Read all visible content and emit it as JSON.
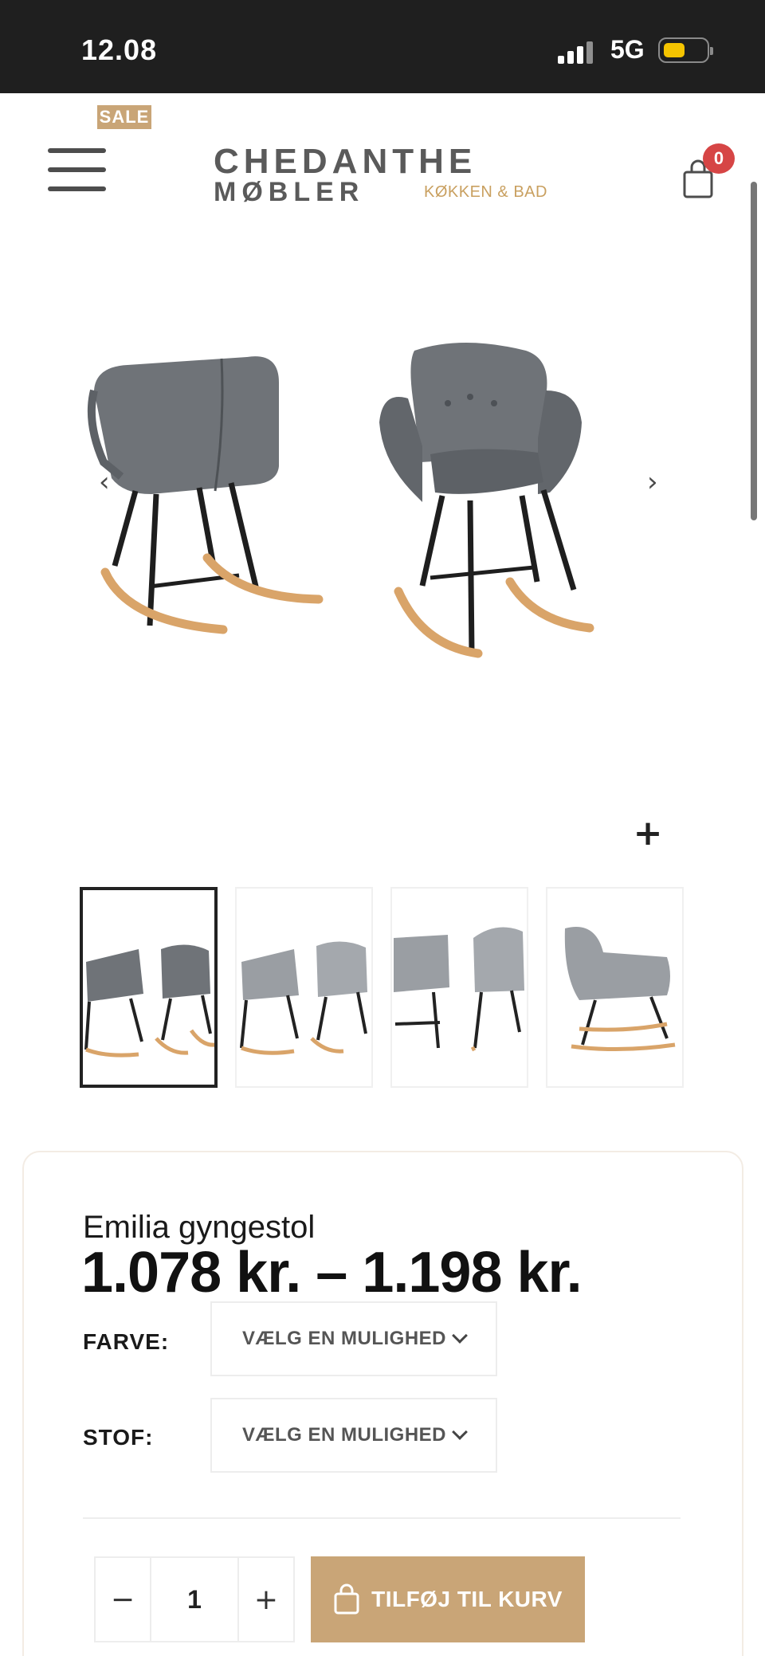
{
  "status_bar": {
    "time": "12.08",
    "network": "5G"
  },
  "header": {
    "sale_badge": "SALE",
    "logo": {
      "line1": "CHEDANTHE",
      "line2": "MØBLER",
      "subtitle": "KØKKEN & BAD"
    },
    "cart_count": "0"
  },
  "gallery": {
    "main_image_alt": "Emilia gyngestol",
    "thumbnail_count": 4,
    "active_index": 0
  },
  "product": {
    "title": "Emilia gyngestol",
    "price": "1.078 kr. – 1.198 kr.",
    "options": [
      {
        "label": "FARVE:",
        "placeholder": "VÆLG EN MULIGHED"
      },
      {
        "label": "STOF:",
        "placeholder": "VÆLG EN MULIGHED"
      }
    ],
    "quantity": "1",
    "qty_minus": "−",
    "qty_plus": "+",
    "add_to_cart": "TILFØJ TIL KURV"
  },
  "colors": {
    "accent": "#c9a577",
    "badge": "#d64545",
    "chair": "#6f7378",
    "chair_light": "#9a9ea3",
    "wood": "#d9a469"
  }
}
